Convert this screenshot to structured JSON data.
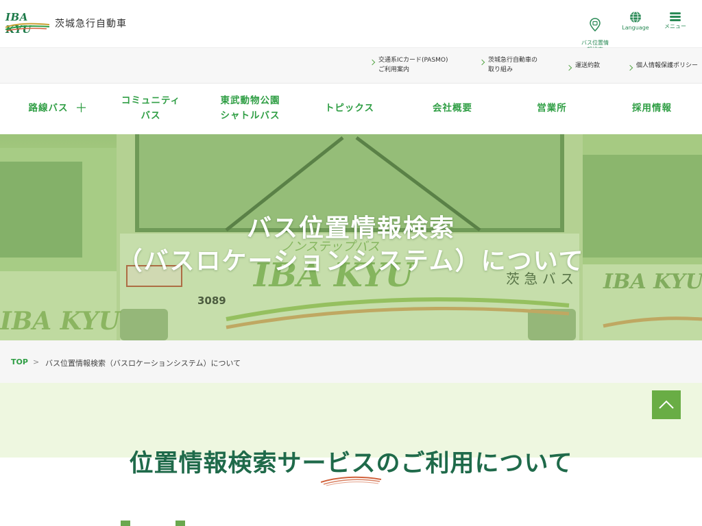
{
  "header": {
    "logo_text": "IBA KYU",
    "company_name": "茨城急行自動車",
    "icons": [
      {
        "label": "バス位置情\n報検索",
        "icon": "bus-location-pin-icon"
      },
      {
        "label": "Language",
        "icon": "globe-icon"
      },
      {
        "label": "メニュー",
        "icon": "menu-icon"
      }
    ]
  },
  "subnav": {
    "links": [
      {
        "line1": "交通系ICカード(PASMO)",
        "line2": "ご利用案内"
      },
      {
        "line1": "茨城急行自動車の",
        "line2": "取り組み"
      },
      {
        "line1": "運送約款",
        "line2": ""
      },
      {
        "line1": "個人情報保護ポリシー",
        "line2": ""
      }
    ]
  },
  "mainnav": {
    "items": [
      {
        "line1": "路線バス",
        "line2": ""
      },
      {
        "line1": "コミュニティ",
        "line2": "バス"
      },
      {
        "line1": "東武動物公園",
        "line2": "シャトルバス"
      },
      {
        "line1": "トピックス",
        "line2": ""
      },
      {
        "line1": "会社概要",
        "line2": ""
      },
      {
        "line1": "営業所",
        "line2": ""
      },
      {
        "line1": "採用情報",
        "line2": ""
      }
    ],
    "expand_symbol": "＋"
  },
  "hero": {
    "title_line1": "バス位置情報検索",
    "title_line2": "（バスロケーションシステム）について",
    "bus_number": "3089",
    "bus_brand": "IBA KYU",
    "bus_label": "ノンステップバス",
    "bus_side": "茨 急 バ ス",
    "side_bus_brand": "IBA KYU"
  },
  "breadcrumb": {
    "home": "TOP",
    "separator": ">",
    "current": "バス位置情報検索（バスロケーションシステム）について"
  },
  "content": {
    "section_title": "位置情報検索サービスのご利用について"
  },
  "colors": {
    "brand_green": "#2f9e44",
    "dark_green": "#1f6a4a",
    "accent_light": "#eef7e0",
    "totop_bg": "#69ad45",
    "swoosh_red": "#d0603a"
  }
}
